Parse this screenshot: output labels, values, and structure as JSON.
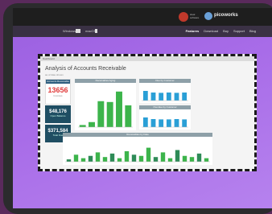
{
  "site": {
    "brand_left_line1": "ideal",
    "brand_left_line2": "software",
    "brand_right": "picoworks",
    "nav_links": [
      "Features",
      "Download",
      "Buy",
      "Support",
      "Blog"
    ],
    "subnav_left": "Windows",
    "subnav_mid": "macOS"
  },
  "dashboard": {
    "header_text": "Dashboard",
    "title": "Analysis of Accounts Receivable",
    "subtitle": "as of date shown",
    "kpi1_caption": "Accounts Receivable",
    "kpi1_value": "13656",
    "kpi1_label": "Invoices",
    "kpi2_value": "$48,176",
    "kpi2_label": "Open Balance",
    "kpi3_value": "$371,584",
    "kpi3_label": "Total Due",
    "bar_caption": "Receivables Aging",
    "right_top_caption": "Due by Customer",
    "right_bot_caption": "Overdue by Customer",
    "bottom_caption": "Receivables by Date"
  },
  "colors": {
    "bar_green": "#3cb44b",
    "bar_dark": "#2e8b57",
    "bar_blue": "#2a9fd6",
    "kpi_dark": "#1f4e63",
    "kpi_red": "#e03c3c"
  },
  "chart_data": [
    {
      "type": "bar",
      "categories": [
        "1",
        "2",
        "3",
        "4",
        "5",
        "6"
      ],
      "values": [
        5,
        12,
        62,
        60,
        85,
        52
      ],
      "ylim": [
        0,
        100
      ]
    },
    {
      "type": "bar",
      "categories": [
        "a",
        "b",
        "c",
        "d",
        "e",
        "f"
      ],
      "values": [
        60,
        50,
        48,
        50,
        48,
        50
      ],
      "ylim": [
        0,
        100
      ]
    },
    {
      "type": "bar",
      "categories": [
        "a",
        "b",
        "c",
        "d",
        "e",
        "f"
      ],
      "values": [
        60,
        50,
        48,
        48,
        50,
        48
      ],
      "ylim": [
        0,
        100
      ]
    },
    {
      "type": "bar",
      "categories": [
        "1",
        "2",
        "3",
        "4",
        "5",
        "6",
        "7",
        "8",
        "9",
        "10",
        "11",
        "12",
        "13",
        "14",
        "15",
        "16",
        "17",
        "18",
        "19",
        "20"
      ],
      "values": [
        10,
        30,
        15,
        25,
        40,
        20,
        35,
        15,
        45,
        30,
        25,
        60,
        20,
        40,
        15,
        50,
        25,
        20,
        35,
        15
      ],
      "ylim": [
        0,
        100
      ]
    }
  ]
}
